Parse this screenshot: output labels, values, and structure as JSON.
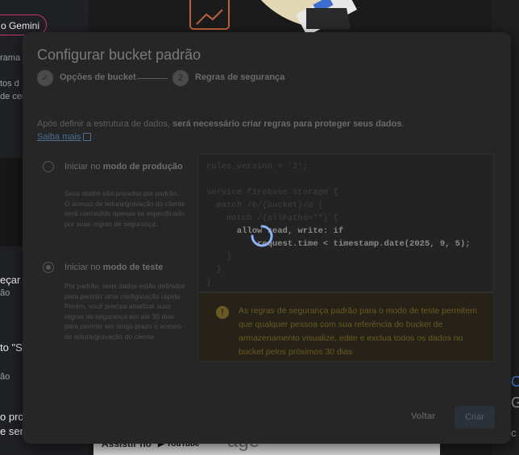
{
  "background": {
    "gemini_pill": "o Gemini",
    "left_snippets": [
      "rama p",
      "tos d",
      "de cert",
      "eçar",
      "ão",
      "to \"S",
      "ão",
      "o pro",
      "e ser"
    ],
    "bottom_banner": {
      "assistir_label": "Assistir no",
      "youtube_label": "YouTube",
      "ghost_text": "age"
    }
  },
  "modal": {
    "title": "Configurar bucket padrão",
    "steps": [
      {
        "number": "✓",
        "label": "Opções de bucket",
        "state": "done"
      },
      {
        "number": "2",
        "label": "Regras de segurança",
        "state": "active"
      }
    ],
    "intro_text": "Após definir a estrutura de dados, ",
    "intro_bold": "será necessário criar regras para proteger seus dados",
    "intro_end": ".",
    "learn_more": "Saiba mais",
    "options": [
      {
        "title_prefix": "Iniciar no ",
        "title_bold": "modo de produção",
        "description": "Seus dados são privados por padrão. O acesso de leitura/gravação do cliente será concedido apenas se especificado por suas regras de segurança.",
        "selected": false
      },
      {
        "title_prefix": "Iniciar no ",
        "title_bold": "modo de teste",
        "description": "Por padrão, seus dados estão definidos para permitir uma configuração rápida. Porém, você precisa atualizar suas regras de segurança em até 30 dias para permitir em longo prazo o acesso de leitura/gravação do cliente.",
        "selected": true
      }
    ],
    "code_lines": [
      "rules_version = '2';",
      "",
      "service firebase.storage {",
      "  match /b/{bucket}/o {",
      "    match /{allPaths=**} {",
      "      allow read, write: if",
      "          request.time < timestamp.date(2025, 9, 5);",
      "    }",
      "  }",
      "}"
    ],
    "warning_text": "As regras de segurança padrão para o modo de teste permitem que qualquer pessoa com sua referência do bucket de armazenamento visualize, edite e exclua todos os dados no bucket pelos próximos 30 dias",
    "back_button": "Voltar",
    "create_button": "Criar"
  },
  "colors": {
    "accent": "#4b6e94",
    "warning": "#6a5a22",
    "spinner": "#8ab4f8"
  }
}
